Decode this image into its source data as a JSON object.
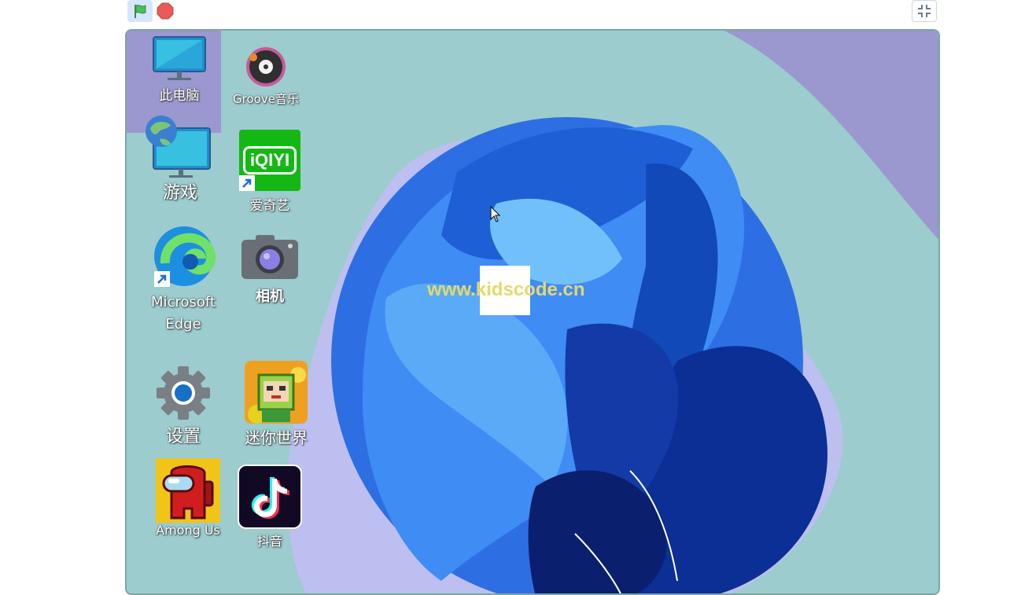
{
  "toolbar": {
    "flag_icon": "green-flag-icon",
    "stop_icon": "stop-icon",
    "fullscreen_icon": "exit-fullscreen-icon",
    "colors": {
      "flag": "#4cbf56",
      "stop": "#ec5959"
    }
  },
  "stage": {
    "watermark": "www.kidscode.cn",
    "desktop_icons": [
      {
        "id": "this-pc",
        "label": "此电脑",
        "icon": "monitor-icon"
      },
      {
        "id": "groove",
        "label": "Groove音乐",
        "icon": "groove-music-icon"
      },
      {
        "id": "games",
        "label": "游戏",
        "icon": "monitor-globe-icon"
      },
      {
        "id": "iqiyi",
        "label": "爱奇艺",
        "icon": "iqiyi-icon",
        "logo_text": "iQIYI"
      },
      {
        "id": "edge",
        "label_line1": "Microsoft",
        "label_line2": "Edge",
        "icon": "edge-icon"
      },
      {
        "id": "camera",
        "label": "相机",
        "icon": "camera-icon"
      },
      {
        "id": "settings",
        "label": "设置",
        "icon": "gear-icon"
      },
      {
        "id": "mini-world",
        "label": "迷你世界",
        "icon": "mini-world-icon"
      },
      {
        "id": "among-us",
        "label": "Among Us",
        "icon": "among-us-icon"
      },
      {
        "id": "douyin",
        "label": "抖音",
        "icon": "douyin-icon"
      }
    ]
  }
}
